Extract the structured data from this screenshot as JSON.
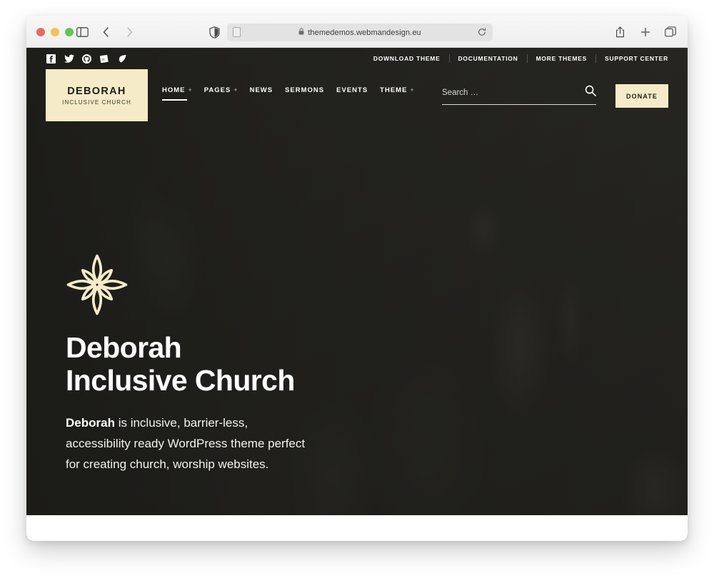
{
  "browser": {
    "url": "themedemos.webmandesign.eu",
    "lock_icon": "lock-icon",
    "reload_icon": "reload-icon",
    "shield_icon": "privacy-shield-icon",
    "reader_icon": "reader-view-icon",
    "sidebar_icon": "sidebar-toggle-icon",
    "back_icon": "back-arrow-icon",
    "forward_icon": "forward-arrow-icon",
    "share_icon": "share-icon",
    "newtab_icon": "plus-icon",
    "tabs_icon": "tab-overview-icon"
  },
  "site": {
    "topbar": {
      "social": [
        {
          "name": "facebook-icon",
          "label": "Facebook"
        },
        {
          "name": "twitter-icon",
          "label": "Twitter"
        },
        {
          "name": "github-icon",
          "label": "GitHub"
        },
        {
          "name": "wordpress-plugin-icon",
          "label": "WordPress"
        },
        {
          "name": "leaf-icon",
          "label": "Leaf"
        }
      ],
      "links": [
        {
          "label": "DOWNLOAD THEME"
        },
        {
          "label": "DOCUMENTATION"
        },
        {
          "label": "MORE THEMES"
        },
        {
          "label": "SUPPORT CENTER"
        }
      ]
    },
    "logo": {
      "title": "DEBORAH",
      "subtitle": "INCLUSIVE CHURCH",
      "bg_color": "#F5EBC8"
    },
    "nav": [
      {
        "label": "HOME",
        "has_submenu": true,
        "active": true
      },
      {
        "label": "PAGES",
        "has_submenu": true,
        "active": false
      },
      {
        "label": "NEWS",
        "has_submenu": false,
        "active": false
      },
      {
        "label": "SERMONS",
        "has_submenu": false,
        "active": false
      },
      {
        "label": "EVENTS",
        "has_submenu": false,
        "active": false
      },
      {
        "label": "THEME",
        "has_submenu": true,
        "active": false
      }
    ],
    "search": {
      "placeholder": "Search …",
      "value": "",
      "icon": "search-icon"
    },
    "donate": {
      "label": "DONATE",
      "bg_color": "#F5EBC8"
    },
    "hero": {
      "ornament_icon": "four-point-flower-ornament-icon",
      "ornament_color": "#F5EBC8",
      "title_line1": "Deborah",
      "title_line2": "Inclusive Church",
      "paragraph_bold": "Deborah",
      "paragraph_rest": " is inclusive, barrier-less, accessibility ready WordPress theme perfect for creating church, worship websites."
    }
  }
}
